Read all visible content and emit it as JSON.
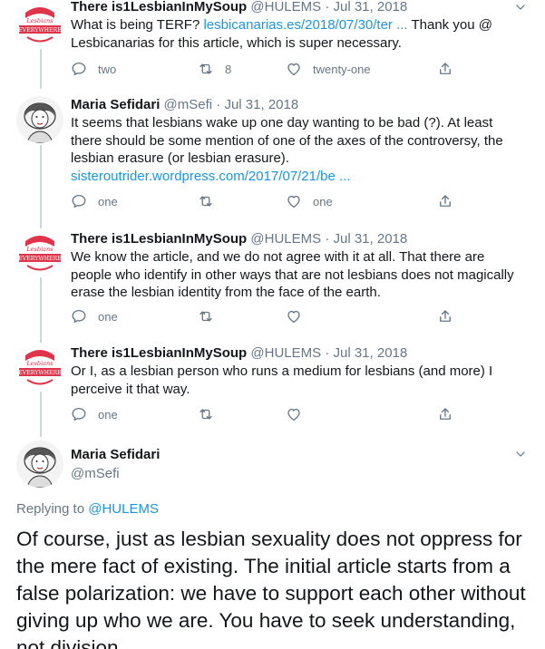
{
  "tweets": [
    {
      "name": "There is1LesbianInMySoup",
      "handle": "@HULEMS",
      "sep": "·",
      "date": "Jul 31, 2018",
      "avatar": "lesbians-everywhere-logo",
      "text_before": "What is being TERF? ",
      "link": "lesbicanarias.es/2018/07/30/ter ...",
      "text_after": " Thank you @ Lesbicanarias for this article, which is super necessary.",
      "reply_count": "two",
      "retweet_count": "8",
      "like_count": "twenty-one"
    },
    {
      "name": "Maria Sefidari",
      "handle": "@mSefi",
      "sep": "·",
      "date": "Jul 31, 2018",
      "avatar": "portrait-illustration",
      "text_before": "It seems that lesbians wake up one day wanting to be bad (?). At least there should be some mention of one of the axes of the controversy, the lesbian erasure (or lesbian erasure).",
      "link": "sisteroutrider.wordpress.com/2017/07/21/be ...",
      "reply_count": "one",
      "retweet_count": "",
      "like_count": "one"
    },
    {
      "name": "There is1LesbianInMySoup",
      "handle": "@HULEMS",
      "sep": "·",
      "date": "Jul 31, 2018",
      "avatar": "lesbians-everywhere-logo",
      "text_before": "We know the article, and we do not agree with it at all. That there are people who identify in other ways that are not lesbians does not magically erase the lesbian identity from the face of the earth.",
      "reply_count": "one"
    },
    {
      "name": "There is1LesbianInMySoup",
      "handle": "@HULEMS",
      "sep": "·",
      "date": "Jul 31, 2018",
      "avatar": "lesbians-everywhere-logo",
      "text_before": "Or I, as a lesbian person who runs a medium for lesbians (and more) I perceive it that way.",
      "reply_count": "one"
    }
  ],
  "focus": {
    "name": "Maria Sefidari",
    "handle": "@mSefi",
    "replying_label": "Replying to ",
    "replying_to": "@HULEMS",
    "text": "Of course, just as lesbian sexuality does not oppress for the mere fact of existing. The initial article starts from a false polarization: we have to support each other without giving up who we are. You have to seek understanding, not division."
  },
  "colors": {
    "link": "#1b95e0",
    "muted": "#657786",
    "thread_line": "#ccd6dd",
    "logo_red": "#e0344a"
  },
  "icons": [
    "reply-icon",
    "retweet-icon",
    "like-icon",
    "share-icon",
    "chevron-down-icon"
  ]
}
